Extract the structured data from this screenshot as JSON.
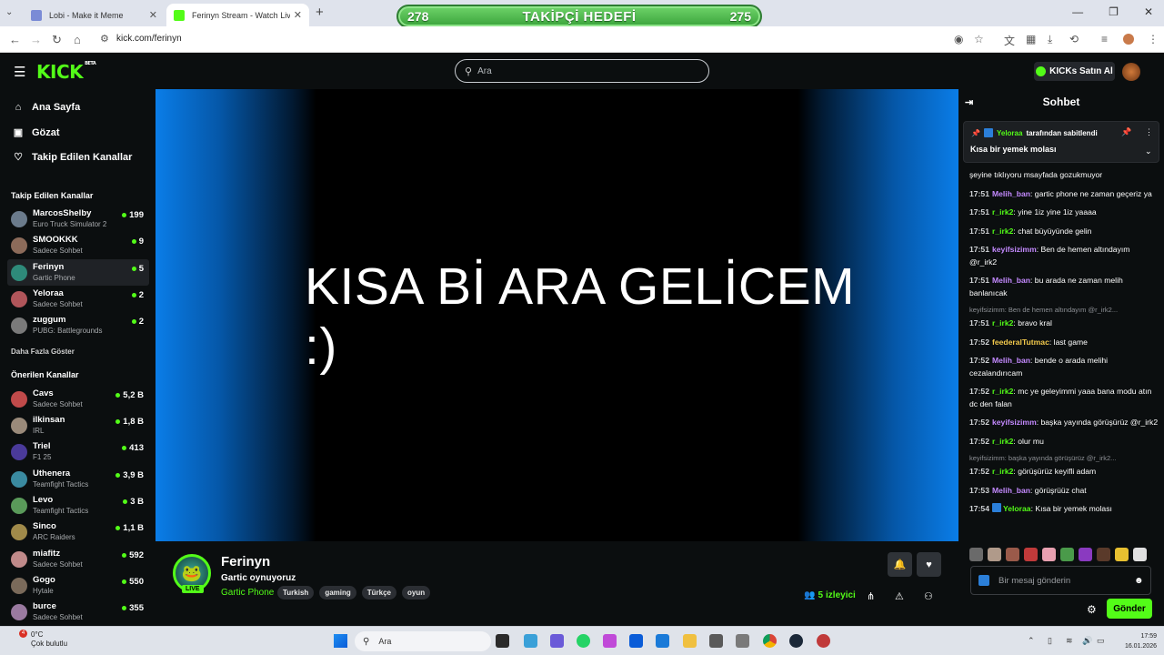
{
  "browser": {
    "tabs": [
      {
        "title": "Lobi - Make it Meme",
        "active": false
      },
      {
        "title": "Ferinyn Stream - Watch Live on",
        "active": true
      }
    ],
    "goal": {
      "left": "278",
      "title": "TAKİPÇİ HEDEFİ",
      "right": "275"
    },
    "url": "kick.com/ferinyn"
  },
  "header": {
    "logo": "KICK",
    "logo_sup": "BETA",
    "search_placeholder": "Ara",
    "buy_label": "KICKs Satın Al"
  },
  "sidebar": {
    "nav": [
      {
        "label": "Ana Sayfa",
        "icon": "home-icon"
      },
      {
        "label": "Gözat",
        "icon": "browse-icon"
      },
      {
        "label": "Takip Edilen Kanallar",
        "icon": "heart-icon"
      }
    ],
    "followed_title": "Takip Edilen Kanallar",
    "followed": [
      {
        "name": "MarcosShelby",
        "category": "Euro Truck Simulator 2",
        "count": "199",
        "color": "#6b7b8c"
      },
      {
        "name": "SMOOKKK",
        "category": "Sadece Sohbet",
        "count": "9",
        "color": "#8c6b5a"
      },
      {
        "name": "Ferinyn",
        "category": "Gartic Phone",
        "count": "5",
        "color": "#2e8a7a"
      },
      {
        "name": "Yeloraa",
        "category": "Sadece Sohbet",
        "count": "2",
        "color": "#b0555a"
      },
      {
        "name": "zuggum",
        "category": "PUBG: Battlegrounds",
        "count": "2",
        "color": "#7a7a7a"
      }
    ],
    "show_more": "Daha Fazla Göster",
    "recommended_title": "Önerilen Kanallar",
    "recommended": [
      {
        "name": "Cavs",
        "category": "Sadece Sohbet",
        "count": "5,2 B",
        "color": "#c04a4a"
      },
      {
        "name": "ilkinsan",
        "category": "IRL",
        "count": "1,8 B",
        "color": "#9a8a7a"
      },
      {
        "name": "Triel",
        "category": "F1 25",
        "count": "413",
        "color": "#4a3a9a"
      },
      {
        "name": "Uthenera",
        "category": "Teamfight Tactics",
        "count": "3,9 B",
        "color": "#3a8aa0"
      },
      {
        "name": "Levo",
        "category": "Teamfight Tactics",
        "count": "3 B",
        "color": "#5a9a5a"
      },
      {
        "name": "Sinco",
        "category": "ARC Raiders",
        "count": "1,1 B",
        "color": "#a08a4a"
      },
      {
        "name": "miafitz",
        "category": "Sadece Sohbet",
        "count": "592",
        "color": "#c08a8a"
      },
      {
        "name": "Gogo",
        "category": "Hytale",
        "count": "550",
        "color": "#7a6a5a"
      },
      {
        "name": "burce",
        "category": "Sadece Sohbet",
        "count": "355",
        "color": "#9a7aa0"
      }
    ]
  },
  "video": {
    "line1": "KISA Bİ ARA GELİCEM",
    "line2": ":)"
  },
  "stream": {
    "name": "Ferinyn",
    "live": "LIVE",
    "title": "Gartic oynuyoruz",
    "category": "Gartic Phone",
    "tags": [
      "Turkish",
      "gaming",
      "Türkçe",
      "oyun"
    ],
    "viewers": "5",
    "viewers_label": "izleyici"
  },
  "chat": {
    "title": "Sohbet",
    "pinned_user": "Yeloraa",
    "pinned_by": "tarafından sabitlendi",
    "pinned_message": "Kısa bir yemek molası",
    "messages": [
      {
        "time": "",
        "user": "",
        "color": "#53fc18",
        "text": "şeyine tıklıyoru msayfada gozukmuyor",
        "reply": "",
        "badge": false
      },
      {
        "time": "17:51",
        "user": "Melih_ban",
        "color": "#c48aff",
        "text": "gartic phone ne zaman geçeriz ya",
        "reply": "",
        "badge": false
      },
      {
        "time": "17:51",
        "user": "r_irk2",
        "color": "#53fc18",
        "text": "yine 1iz yine 1iz yaaaa",
        "reply": "",
        "badge": false
      },
      {
        "time": "17:51",
        "user": "r_irk2",
        "color": "#53fc18",
        "text": "chat büyüyünde gelin",
        "reply": "",
        "badge": false
      },
      {
        "time": "17:51",
        "user": "keyifsizimm",
        "color": "#c48aff",
        "text": "Ben de hemen altındayım @r_irk2",
        "reply": "",
        "badge": false
      },
      {
        "time": "17:51",
        "user": "Melih_ban",
        "color": "#c48aff",
        "text": "bu arada ne zaman melih banlanıcak",
        "reply": "",
        "badge": false
      },
      {
        "time": "17:51",
        "user": "r_irk2",
        "color": "#53fc18",
        "text": "bravo kral",
        "reply": "keyifsizimm: Ben de hemen altındayım @r_irk2...",
        "badge": false
      },
      {
        "time": "17:52",
        "user": "feederalTutmac",
        "color": "#f2c94c",
        "text": "last game",
        "reply": "",
        "badge": false
      },
      {
        "time": "17:52",
        "user": "Melih_ban",
        "color": "#c48aff",
        "text": "bende o arada melihi cezalandırıcam",
        "reply": "",
        "badge": false
      },
      {
        "time": "17:52",
        "user": "r_irk2",
        "color": "#53fc18",
        "text": "mc ye geleyimmi yaaa bana modu atın dc den falan",
        "reply": "",
        "badge": false
      },
      {
        "time": "17:52",
        "user": "keyifsizimm",
        "color": "#c48aff",
        "text": "başka yayında görüşürüz @r_irk2",
        "reply": "",
        "badge": false
      },
      {
        "time": "17:52",
        "user": "r_irk2",
        "color": "#53fc18",
        "text": "olur mu",
        "reply": "",
        "badge": false
      },
      {
        "time": "17:52",
        "user": "r_irk2",
        "color": "#53fc18",
        "text": "görüşürüz keyifli adam",
        "reply": "keyifsizimm: başka yayında görüşürüz @r_irk2...",
        "badge": false
      },
      {
        "time": "17:53",
        "user": "Melih_ban",
        "color": "#c48aff",
        "text": "görüşrüüz chat",
        "reply": "",
        "badge": false
      },
      {
        "time": "17:54",
        "user": "Yeloraa",
        "color": "#53fc18",
        "text": "Kısa bir yemek molası",
        "reply": "",
        "badge": true
      }
    ],
    "input_placeholder": "Bir mesaj gönderin",
    "send_label": "Gönder"
  },
  "taskbar": {
    "weather_temp": "0°C",
    "weather_desc": "Çok bulutlu",
    "weather_badge": "4",
    "search_label": "Ara",
    "time": "17:59",
    "date": "16.01.2026"
  }
}
